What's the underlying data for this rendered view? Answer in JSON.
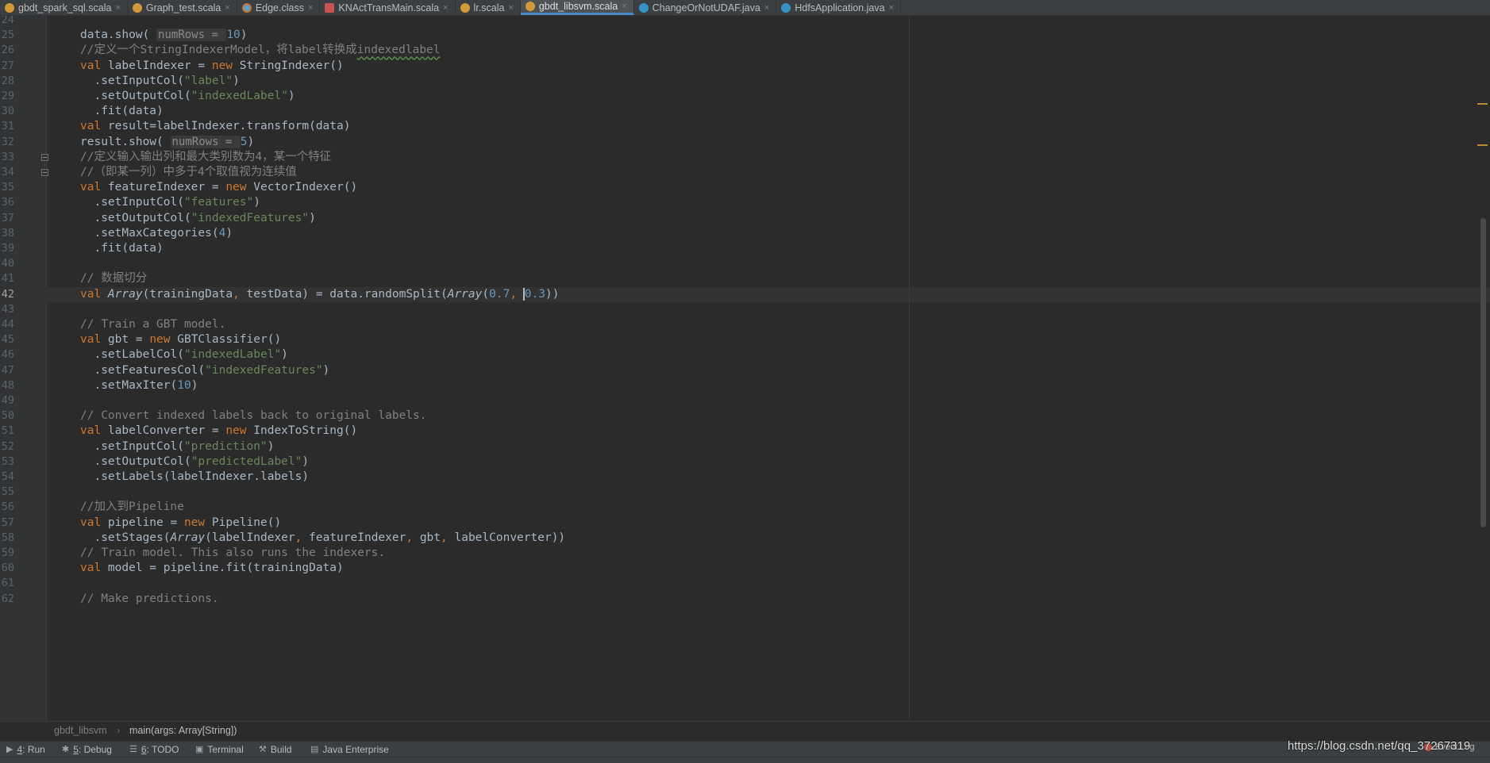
{
  "tabs": [
    {
      "label": "gbdt_spark_sql.scala",
      "icon": "scala-file-icon",
      "active": false
    },
    {
      "label": "Graph_test.scala",
      "icon": "scala-file-icon",
      "active": false
    },
    {
      "label": "Edge.class",
      "icon": "class-file-icon",
      "active": false
    },
    {
      "label": "KNActTransMain.scala",
      "icon": "scala-object-icon",
      "active": false
    },
    {
      "label": "lr.scala",
      "icon": "scala-file-icon",
      "active": false
    },
    {
      "label": "gbdt_libsvm.scala",
      "icon": "scala-file-icon",
      "active": true
    },
    {
      "label": "ChangeOrNotUDAF.java",
      "icon": "java-class-icon",
      "active": false
    },
    {
      "label": "HdfsApplication.java",
      "icon": "java-class-icon",
      "active": false
    }
  ],
  "tab_close_glyph": "×",
  "editor": {
    "current_line": "42",
    "lines": [
      {
        "n": "24",
        "seg": []
      },
      {
        "n": "25",
        "seg": [
          [
            "",
            "data.show( "
          ],
          [
            "hint",
            "numRows = "
          ],
          [
            "num",
            "10"
          ],
          [
            "",
            ")"
          ]
        ]
      },
      {
        "n": "26",
        "seg": [
          [
            "cm",
            "//定义一个StringIndexerModel，将label转换成"
          ],
          [
            "cm typo",
            "indexedlabel"
          ]
        ]
      },
      {
        "n": "27",
        "seg": [
          [
            "kw",
            "val "
          ],
          [
            "",
            "labelIndexer = "
          ],
          [
            "kw",
            "new "
          ],
          [
            "",
            "StringIndexer()"
          ]
        ]
      },
      {
        "n": "28",
        "seg": [
          [
            "",
            "  .setInputCol("
          ],
          [
            "str",
            "\"label\""
          ],
          [
            "",
            ")"
          ]
        ]
      },
      {
        "n": "29",
        "seg": [
          [
            "",
            "  .setOutputCol("
          ],
          [
            "str",
            "\"indexedLabel\""
          ],
          [
            "",
            ")"
          ]
        ]
      },
      {
        "n": "30",
        "seg": [
          [
            "",
            "  .fit(data)"
          ]
        ]
      },
      {
        "n": "31",
        "seg": [
          [
            "kw",
            "val "
          ],
          [
            "",
            "result=labelIndexer.transform(data)"
          ]
        ]
      },
      {
        "n": "32",
        "seg": [
          [
            "",
            "result.show( "
          ],
          [
            "hint",
            "numRows = "
          ],
          [
            "num",
            "5"
          ],
          [
            "",
            ")"
          ]
        ]
      },
      {
        "n": "33",
        "fold": true,
        "seg": [
          [
            "cm",
            "//定义输入输出列和最大类别数为4，某一个特征"
          ]
        ]
      },
      {
        "n": "34",
        "fold": true,
        "seg": [
          [
            "cm",
            "//（即某一列）中多于4个取值视为连续值"
          ]
        ]
      },
      {
        "n": "35",
        "seg": [
          [
            "kw",
            "val "
          ],
          [
            "",
            "featureIndexer = "
          ],
          [
            "kw",
            "new "
          ],
          [
            "",
            "VectorIndexer()"
          ]
        ]
      },
      {
        "n": "36",
        "seg": [
          [
            "",
            "  .setInputCol("
          ],
          [
            "str",
            "\"features\""
          ],
          [
            "",
            ")"
          ]
        ]
      },
      {
        "n": "37",
        "seg": [
          [
            "",
            "  .setOutputCol("
          ],
          [
            "str",
            "\"indexedFeatures\""
          ],
          [
            "",
            ")"
          ]
        ]
      },
      {
        "n": "38",
        "seg": [
          [
            "",
            "  .setMaxCategories("
          ],
          [
            "num",
            "4"
          ],
          [
            "",
            ")"
          ]
        ]
      },
      {
        "n": "39",
        "seg": [
          [
            "",
            "  .fit(data)"
          ]
        ]
      },
      {
        "n": "40",
        "seg": []
      },
      {
        "n": "41",
        "seg": [
          [
            "cm",
            "// 数据切分"
          ]
        ]
      },
      {
        "n": "42",
        "seg": [
          [
            "kw",
            "val "
          ],
          [
            "it",
            "Array"
          ],
          [
            "",
            "(trainingData"
          ],
          [
            "kw",
            ", "
          ],
          [
            "",
            "testData) = data.randomSplit("
          ],
          [
            "it",
            "Array"
          ],
          [
            "",
            "("
          ],
          [
            "num",
            "0.7"
          ],
          [
            "kw",
            ", "
          ],
          [
            "num caret",
            "0.3"
          ],
          [
            "",
            "))"
          ]
        ]
      },
      {
        "n": "43",
        "seg": []
      },
      {
        "n": "44",
        "seg": [
          [
            "cm",
            "// Train a GBT model."
          ]
        ]
      },
      {
        "n": "45",
        "seg": [
          [
            "kw",
            "val "
          ],
          [
            "",
            "gbt = "
          ],
          [
            "kw",
            "new "
          ],
          [
            "",
            "GBTClassifier()"
          ]
        ]
      },
      {
        "n": "46",
        "seg": [
          [
            "",
            "  .setLabelCol("
          ],
          [
            "str",
            "\"indexedLabel\""
          ],
          [
            "",
            ")"
          ]
        ]
      },
      {
        "n": "47",
        "seg": [
          [
            "",
            "  .setFeaturesCol("
          ],
          [
            "str",
            "\"indexedFeatures\""
          ],
          [
            "",
            ")"
          ]
        ]
      },
      {
        "n": "48",
        "seg": [
          [
            "",
            "  .setMaxIter("
          ],
          [
            "num",
            "10"
          ],
          [
            "",
            ")"
          ]
        ]
      },
      {
        "n": "49",
        "seg": []
      },
      {
        "n": "50",
        "seg": [
          [
            "cm",
            "// Convert indexed labels back to original labels."
          ]
        ]
      },
      {
        "n": "51",
        "seg": [
          [
            "kw",
            "val "
          ],
          [
            "",
            "labelConverter = "
          ],
          [
            "kw",
            "new "
          ],
          [
            "",
            "IndexToString()"
          ]
        ]
      },
      {
        "n": "52",
        "seg": [
          [
            "",
            "  .setInputCol("
          ],
          [
            "str",
            "\"prediction\""
          ],
          [
            "",
            ")"
          ]
        ]
      },
      {
        "n": "53",
        "seg": [
          [
            "",
            "  .setOutputCol("
          ],
          [
            "str",
            "\"predictedLabel\""
          ],
          [
            "",
            ")"
          ]
        ]
      },
      {
        "n": "54",
        "seg": [
          [
            "",
            "  .setLabels(labelIndexer.labels)"
          ]
        ]
      },
      {
        "n": "55",
        "seg": []
      },
      {
        "n": "56",
        "seg": [
          [
            "cm",
            "//加入到Pipeline"
          ]
        ]
      },
      {
        "n": "57",
        "seg": [
          [
            "kw",
            "val "
          ],
          [
            "",
            "pipeline = "
          ],
          [
            "kw",
            "new "
          ],
          [
            "",
            "Pipeline()"
          ]
        ]
      },
      {
        "n": "58",
        "seg": [
          [
            "",
            "  .setStages("
          ],
          [
            "it",
            "Array"
          ],
          [
            "",
            "(labelIndexer"
          ],
          [
            "kw",
            ", "
          ],
          [
            "",
            "featureIndexer"
          ],
          [
            "kw",
            ", "
          ],
          [
            "",
            "gbt"
          ],
          [
            "kw",
            ", "
          ],
          [
            "",
            "labelConverter))"
          ]
        ]
      },
      {
        "n": "59",
        "seg": [
          [
            "cm",
            "// Train model. This also runs the indexers."
          ]
        ]
      },
      {
        "n": "60",
        "seg": [
          [
            "kw",
            "val "
          ],
          [
            "",
            "model = pipeline.fit(trainingData)"
          ]
        ]
      },
      {
        "n": "61",
        "seg": []
      },
      {
        "n": "62",
        "seg": [
          [
            "cm",
            "// Make predictions."
          ]
        ]
      }
    ]
  },
  "breadcrumb": {
    "file": "gbdt_libsvm",
    "separator": "›",
    "method": "main(args: Array[String])"
  },
  "toolbar": {
    "run_num": "4",
    "run_label": ": Run",
    "debug_num": "5",
    "debug_label": ": Debug",
    "todo_num": "6",
    "todo_label": ": TODO",
    "terminal_label": "Terminal",
    "build_label": "Build",
    "java_ee_label": "Java Enterprise",
    "event_log_label": "Event Log"
  },
  "watermark": "https://blog.csdn.net/qq_37267319",
  "colors": {
    "background": "#2b2b2b",
    "keyword": "#cc7832",
    "string": "#6a8759",
    "number": "#6897bb",
    "comment": "#808080",
    "active_tab_underline": "#4a88c7"
  }
}
